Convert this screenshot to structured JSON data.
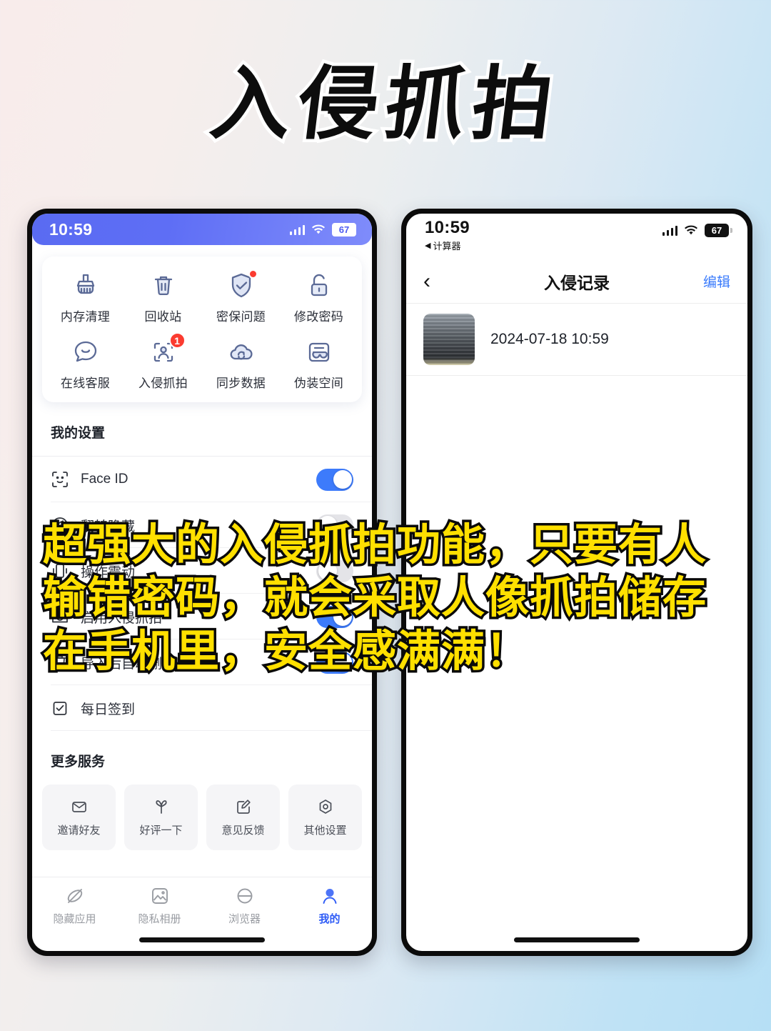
{
  "headline": "入侵抓拍",
  "caption": "超强大的入侵抓拍功能，只要有人输错密码，就会采取人像抓拍储存在手机里，安全感满满！",
  "colors": {
    "accent_blue": "#3d7bfb",
    "badge_red": "#fb3b30",
    "caption_yellow": "#ffe000",
    "icon_blue_gray": "#5b6a96",
    "link_blue": "#3a7bfc"
  },
  "left_phone": {
    "status": {
      "time": "10:59",
      "battery": "67",
      "signal_icon": "signal-bars-icon",
      "wifi_icon": "wifi-icon"
    },
    "grid": [
      {
        "icon": "broom-icon",
        "label": "内存清理",
        "badge": null
      },
      {
        "icon": "trash-icon",
        "label": "回收站",
        "badge": null
      },
      {
        "icon": "shield-check-icon",
        "label": "密保问题",
        "badge": "dot"
      },
      {
        "icon": "unlock-icon",
        "label": "修改密码",
        "badge": null
      },
      {
        "icon": "chat-smile-icon",
        "label": "在线客服",
        "badge": null
      },
      {
        "icon": "face-scan-icon",
        "label": "入侵抓拍",
        "badge": "1"
      },
      {
        "icon": "cloud-sync-icon",
        "label": "同步数据",
        "badge": null
      },
      {
        "icon": "mask-card-icon",
        "label": "伪装空间",
        "badge": null
      }
    ],
    "settings_title": "我的设置",
    "settings": [
      {
        "icon": "face-id-icon",
        "label": "Face ID",
        "toggle": "on"
      },
      {
        "icon": "flip-icon",
        "label": "翻转隐藏",
        "toggle": "off"
      },
      {
        "icon": "vibrate-icon",
        "label": "操作震动",
        "toggle": "off"
      },
      {
        "icon": "camera-icon",
        "label": "启用入侵抓拍",
        "toggle": "on"
      },
      {
        "icon": "delete-file-icon",
        "label": "导入后自动删除原文件",
        "toggle": "on"
      },
      {
        "icon": "checkin-icon",
        "label": "每日签到",
        "toggle": null
      }
    ],
    "more_title": "更多服务",
    "more_services": [
      {
        "icon": "envelope-icon",
        "label": "邀请好友"
      },
      {
        "icon": "flower-icon",
        "label": "好评一下"
      },
      {
        "icon": "feedback-icon",
        "label": "意见反馈"
      },
      {
        "icon": "hex-gear-icon",
        "label": "其他设置"
      }
    ],
    "tabs": [
      {
        "icon": "hidden-app-icon",
        "label": "隐藏应用",
        "active": false
      },
      {
        "icon": "photo-icon",
        "label": "隐私相册",
        "active": false
      },
      {
        "icon": "browser-icon",
        "label": "浏览器",
        "active": false
      },
      {
        "icon": "profile-icon",
        "label": "我的",
        "active": true
      }
    ]
  },
  "right_phone": {
    "status": {
      "time": "10:59",
      "back_app": "计算器",
      "battery": "67",
      "signal_icon": "signal-bars-icon",
      "wifi_icon": "wifi-icon"
    },
    "nav": {
      "back_icon": "chevron-left-icon",
      "title": "入侵记录",
      "edit_label": "编辑"
    },
    "records": [
      {
        "thumbnail": "capture-thumbnail",
        "time": "2024-07-18 10:59"
      }
    ]
  }
}
